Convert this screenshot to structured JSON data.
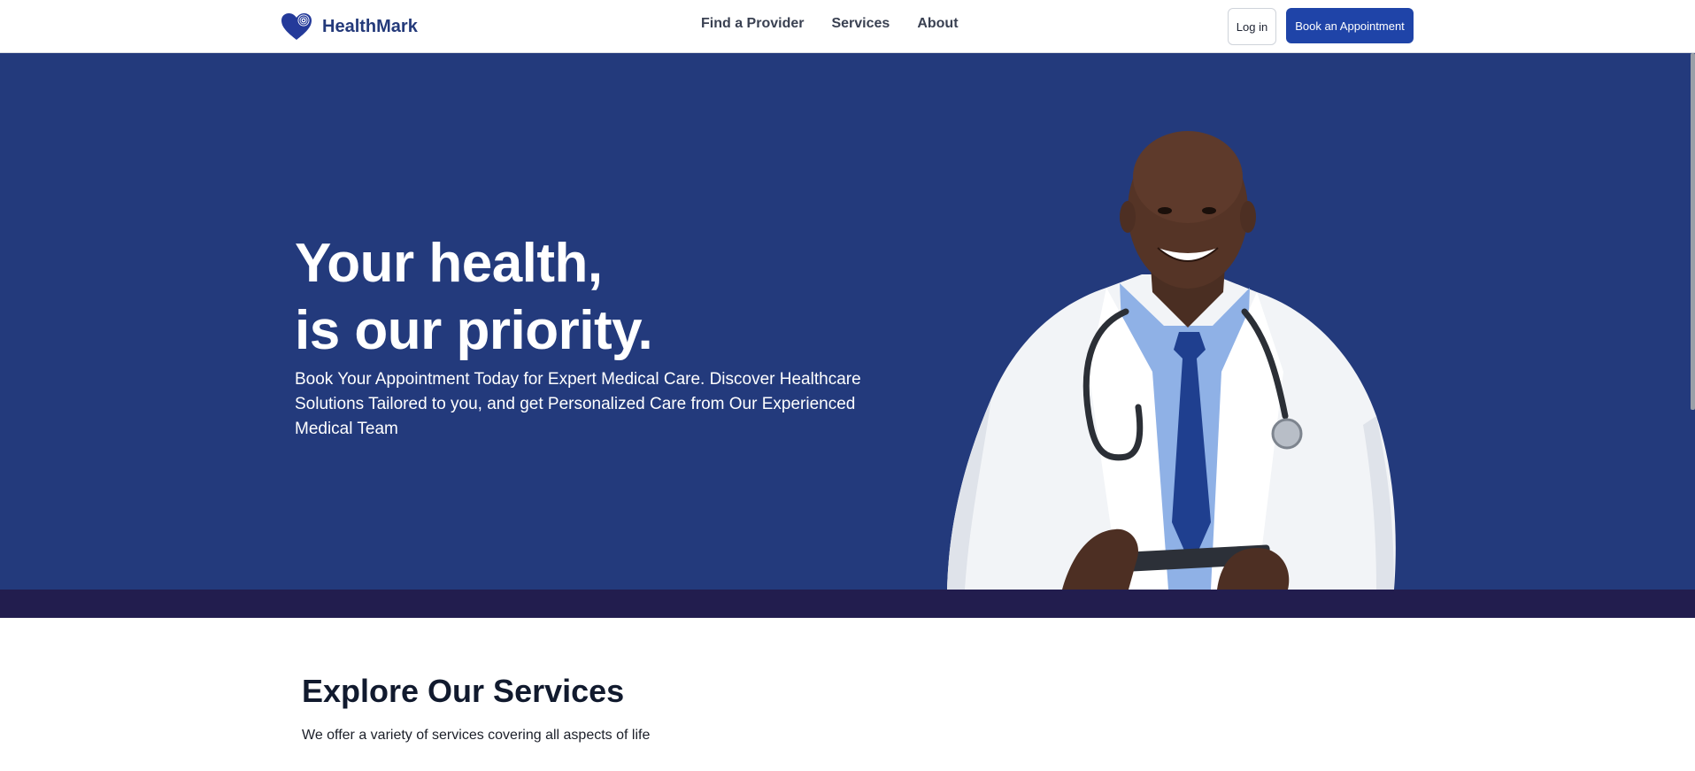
{
  "header": {
    "brand": "HealthMark",
    "nav": [
      "Find a Provider",
      "Services",
      "About"
    ],
    "login_label": "Log in",
    "book_label": "Book an Appointment"
  },
  "hero": {
    "title_line1": "Your health,",
    "title_line2": "is our priority.",
    "subtitle": "Book Your Appointment Today for Expert Medical Care. Discover Healthcare Solutions Tailored to you, and get Personalized Care from Our Experienced Medical Team"
  },
  "services": {
    "title": "Explore Our Services",
    "subtitle": "We offer a variety of services covering all aspects of life"
  },
  "colors": {
    "brand_blue": "#1f44a8",
    "hero_bg": "#233a7c",
    "band": "#221d4e"
  }
}
